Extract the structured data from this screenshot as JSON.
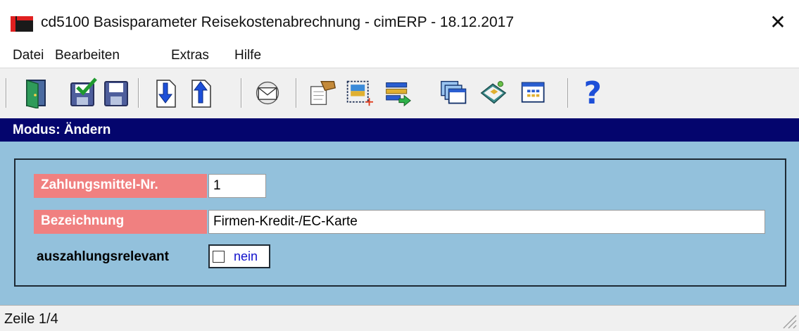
{
  "window": {
    "title": "cd5100 Basisparameter Reisekostenabrechnung - cimERP - 18.12.2017",
    "close_glyph": "✕"
  },
  "menu": {
    "items": [
      {
        "label": "Datei"
      },
      {
        "label": "Bearbeiten"
      },
      {
        "label": "Extras"
      },
      {
        "label": "Hilfe"
      }
    ]
  },
  "toolbar": {
    "buttons": [
      {
        "icon": "exit-door-icon"
      },
      {
        "icon": "save-check-icon"
      },
      {
        "icon": "save-icon"
      },
      {
        "icon": "arrow-down-page-icon"
      },
      {
        "icon": "arrow-up-page-icon"
      },
      {
        "icon": "envelope-icon"
      },
      {
        "icon": "handshake-document-icon"
      },
      {
        "icon": "new-record-icon"
      },
      {
        "icon": "transfer-list-icon"
      },
      {
        "icon": "windows-cascade-icon"
      },
      {
        "icon": "book-icon"
      },
      {
        "icon": "table-grid-icon"
      },
      {
        "icon": "help-icon"
      }
    ],
    "help_glyph": "?"
  },
  "mode": {
    "text": "Modus: Ändern"
  },
  "form": {
    "zahlungsmittel_label": "Zahlungsmittel-Nr.",
    "zahlungsmittel_value": "1",
    "bezeichnung_label": "Bezeichnung",
    "bezeichnung_value": "Firmen-Kredit-/EC-Karte",
    "auszahlung_label": "auszahlungsrelevant",
    "auszahlung_checked": false,
    "auszahlung_text": "nein"
  },
  "status": {
    "text": "Zeile 1/4"
  },
  "colors": {
    "mode_bar": "#04056d",
    "form_background": "#93c1dc",
    "label_background": "#f08080"
  }
}
